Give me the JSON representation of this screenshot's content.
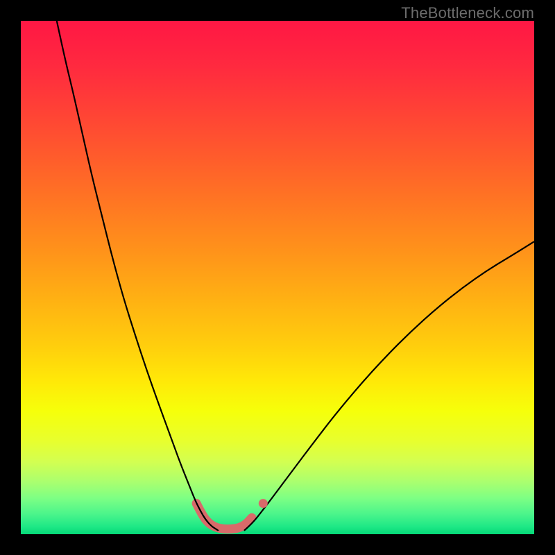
{
  "watermark": "TheBottleneck.com",
  "chart_data": {
    "type": "line",
    "title": "",
    "xlabel": "",
    "ylabel": "",
    "xlim": [
      0,
      100
    ],
    "ylim": [
      0,
      100
    ],
    "grid": false,
    "background_gradient": {
      "stops": [
        {
          "offset": 0.0,
          "color": "#ff1744"
        },
        {
          "offset": 0.09,
          "color": "#ff2a3f"
        },
        {
          "offset": 0.18,
          "color": "#ff4335"
        },
        {
          "offset": 0.27,
          "color": "#ff5d2b"
        },
        {
          "offset": 0.36,
          "color": "#ff7822"
        },
        {
          "offset": 0.45,
          "color": "#ff931a"
        },
        {
          "offset": 0.54,
          "color": "#ffb013"
        },
        {
          "offset": 0.63,
          "color": "#ffcd0d"
        },
        {
          "offset": 0.7,
          "color": "#ffe808"
        },
        {
          "offset": 0.76,
          "color": "#f6ff0a"
        },
        {
          "offset": 0.82,
          "color": "#e7ff2f"
        },
        {
          "offset": 0.86,
          "color": "#d2ff52"
        },
        {
          "offset": 0.9,
          "color": "#a8ff70"
        },
        {
          "offset": 0.93,
          "color": "#7dff84"
        },
        {
          "offset": 0.96,
          "color": "#4cf58b"
        },
        {
          "offset": 0.985,
          "color": "#1fe886"
        },
        {
          "offset": 1.0,
          "color": "#05d978"
        }
      ]
    },
    "series": [
      {
        "name": "bottleneck-curve-left",
        "color": "#000000",
        "width": 2.2,
        "points": [
          {
            "x": 7.0,
            "y": 100.0
          },
          {
            "x": 8.5,
            "y": 93.0
          },
          {
            "x": 10.2,
            "y": 86.0
          },
          {
            "x": 12.0,
            "y": 78.0
          },
          {
            "x": 13.8,
            "y": 70.0
          },
          {
            "x": 15.8,
            "y": 62.0
          },
          {
            "x": 17.8,
            "y": 54.0
          },
          {
            "x": 20.0,
            "y": 46.0
          },
          {
            "x": 22.2,
            "y": 39.0
          },
          {
            "x": 24.5,
            "y": 32.0
          },
          {
            "x": 26.8,
            "y": 25.5
          },
          {
            "x": 29.0,
            "y": 19.5
          },
          {
            "x": 31.0,
            "y": 14.0
          },
          {
            "x": 32.8,
            "y": 9.5
          },
          {
            "x": 34.0,
            "y": 6.5
          },
          {
            "x": 35.0,
            "y": 4.5
          },
          {
            "x": 36.0,
            "y": 2.8
          },
          {
            "x": 37.2,
            "y": 1.5
          },
          {
            "x": 38.5,
            "y": 0.7
          }
        ]
      },
      {
        "name": "bottleneck-curve-right",
        "color": "#000000",
        "width": 2.2,
        "points": [
          {
            "x": 43.5,
            "y": 0.7
          },
          {
            "x": 45.0,
            "y": 2.0
          },
          {
            "x": 47.0,
            "y": 4.5
          },
          {
            "x": 49.5,
            "y": 7.8
          },
          {
            "x": 53.0,
            "y": 12.5
          },
          {
            "x": 57.0,
            "y": 17.8
          },
          {
            "x": 61.0,
            "y": 23.0
          },
          {
            "x": 66.0,
            "y": 29.0
          },
          {
            "x": 71.0,
            "y": 34.5
          },
          {
            "x": 76.0,
            "y": 39.5
          },
          {
            "x": 81.0,
            "y": 44.0
          },
          {
            "x": 86.0,
            "y": 48.0
          },
          {
            "x": 91.0,
            "y": 51.5
          },
          {
            "x": 96.0,
            "y": 54.5
          },
          {
            "x": 100.0,
            "y": 57.0
          }
        ]
      },
      {
        "name": "optimum-highlight",
        "color": "#d86a6a",
        "width": 13,
        "linecap": "round",
        "points": [
          {
            "x": 34.2,
            "y": 6.0
          },
          {
            "x": 35.3,
            "y": 3.8
          },
          {
            "x": 36.5,
            "y": 2.2
          },
          {
            "x": 38.0,
            "y": 1.3
          },
          {
            "x": 39.5,
            "y": 1.0
          },
          {
            "x": 41.0,
            "y": 1.0
          },
          {
            "x": 42.5,
            "y": 1.2
          },
          {
            "x": 43.8,
            "y": 1.9
          },
          {
            "x": 45.0,
            "y": 3.2
          }
        ]
      }
    ],
    "markers": [
      {
        "name": "highlight-dot",
        "x": 47.2,
        "y": 6.0,
        "r": 6.5,
        "color": "#d86a6a"
      }
    ]
  }
}
